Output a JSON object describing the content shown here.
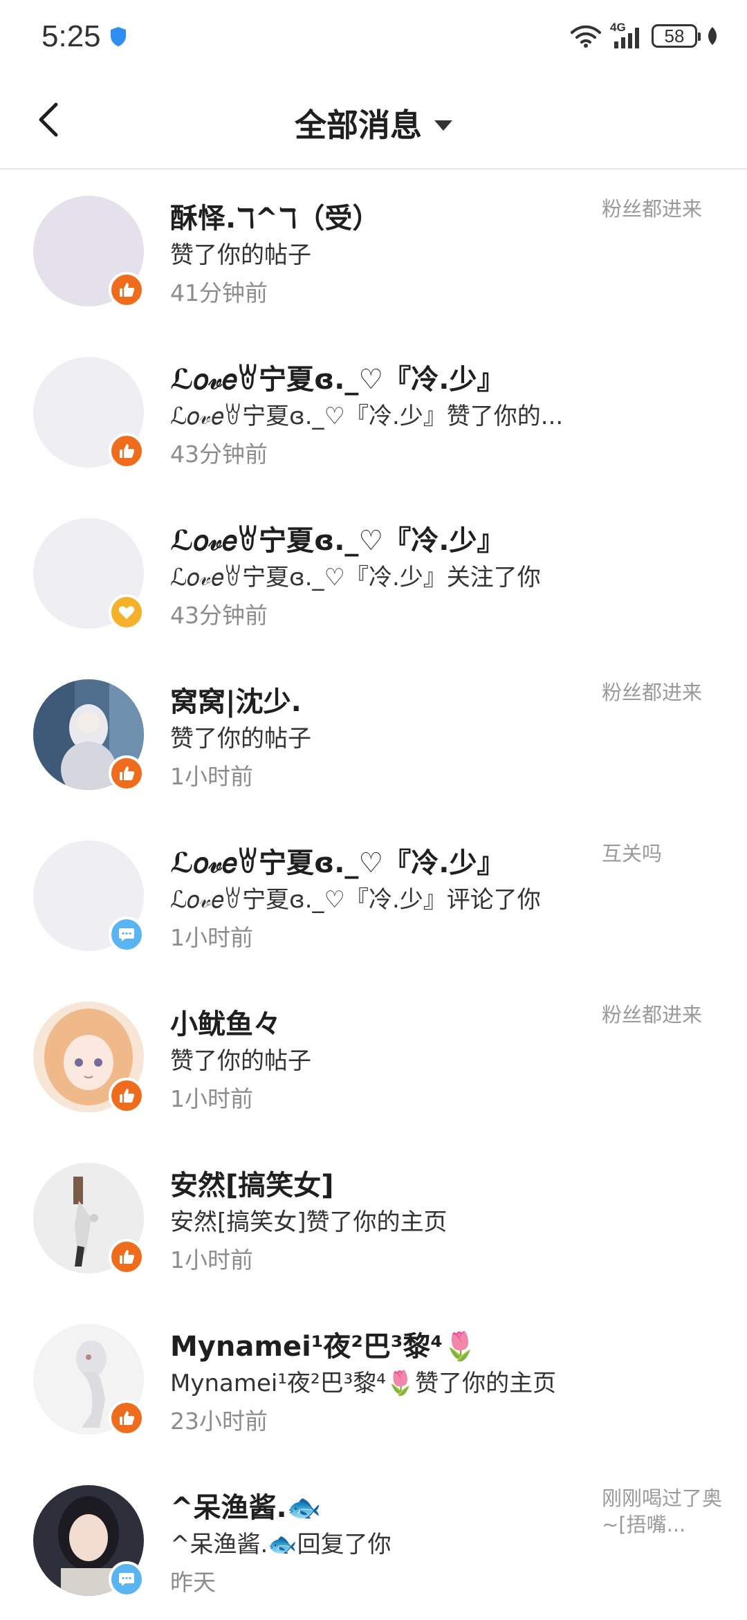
{
  "status_bar": {
    "time": "5:25",
    "network": "4G",
    "battery": "58"
  },
  "header": {
    "title": "全部消息"
  },
  "messages": [
    {
      "name": "酥怿.ℸ^ℸ（受）",
      "action": "赞了你的帖子",
      "time": "41分钟前",
      "tag": "粉丝都进来",
      "badge": "like-icon",
      "avatar_color": "#e4e0ec"
    },
    {
      "name": "ℒ𝑜𝓋𝑒ꇐ宁夏ɞ._♡『冷.少』",
      "action": "ℒ𝑜𝓋𝑒ꇐ宁夏ɞ._♡『冷.少』赞了你的...",
      "time": "43分钟前",
      "tag": "",
      "badge": "like-icon",
      "avatar_color": "#efeef2"
    },
    {
      "name": "ℒ𝑜𝓋𝑒ꇐ宁夏ɞ._♡『冷.少』",
      "action": "ℒ𝑜𝓋𝑒ꇐ宁夏ɞ._♡『冷.少』关注了你",
      "time": "43分钟前",
      "tag": "",
      "badge": "heart-icon",
      "avatar_color": "#efeef2"
    },
    {
      "name": "窝窝|沈少.",
      "action": "赞了你的帖子",
      "time": "1小时前",
      "tag": "粉丝都进来",
      "badge": "like-icon",
      "avatar_color": "#5f7a96"
    },
    {
      "name": "ℒ𝑜𝓋𝑒ꇐ宁夏ɞ._♡『冷.少』",
      "action": "ℒ𝑜𝓋𝑒ꇐ宁夏ɞ._♡『冷.少』评论了你",
      "time": "1小时前",
      "tag": "互关吗",
      "badge": "comment-icon",
      "avatar_color": "#efeef2"
    },
    {
      "name": "小鱿鱼々",
      "action": "赞了你的帖子",
      "time": "1小时前",
      "tag": "粉丝都进来",
      "badge": "like-icon",
      "avatar_color": "#f3cfae"
    },
    {
      "name": "安然[搞笑女]",
      "action": "安然[搞笑女]赞了你的主页",
      "time": "1小时前",
      "tag": "",
      "badge": "like-icon",
      "avatar_color": "#ededed"
    },
    {
      "name": "Mynamei¹夜²巴³黎⁴🌷",
      "action": "Mynamei¹夜²巴³黎⁴🌷赞了你的主页",
      "time": "23小时前",
      "tag": "",
      "badge": "like-icon",
      "avatar_color": "#f1f1f1"
    },
    {
      "name": "^呆渔酱.🐟",
      "action": "^呆渔酱.🐟回复了你",
      "time": "昨天",
      "tag": "刚刚喝过了奥~[捂嘴...",
      "badge": "comment-icon",
      "avatar_color": "#3b3b45"
    }
  ]
}
